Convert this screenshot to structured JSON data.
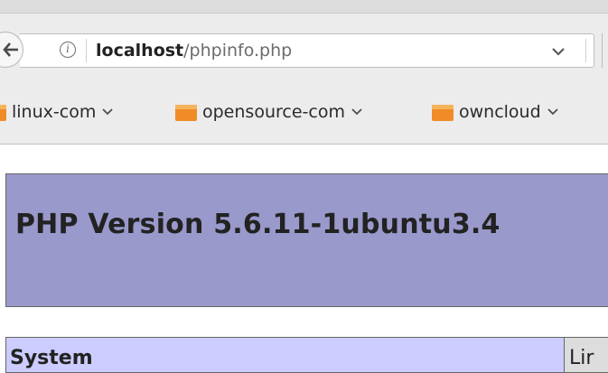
{
  "address_bar": {
    "host": "localhost",
    "path": "/phpinfo.php"
  },
  "bookmarks": [
    {
      "label": "linux-com",
      "icon": "folder-icon"
    },
    {
      "label": "opensource-com",
      "icon": "folder-icon"
    },
    {
      "label": "owncloud",
      "icon": "folder-icon"
    }
  ],
  "page": {
    "title": "PHP Version 5.6.11-1ubuntu3.4",
    "table": {
      "row_label": "System",
      "row_value": "Lir"
    }
  },
  "colors": {
    "header_bg": "#9999cc",
    "label_cell_bg": "#ccccff",
    "value_cell_bg": "#dddddd",
    "folder_orange": "#f08c28"
  }
}
